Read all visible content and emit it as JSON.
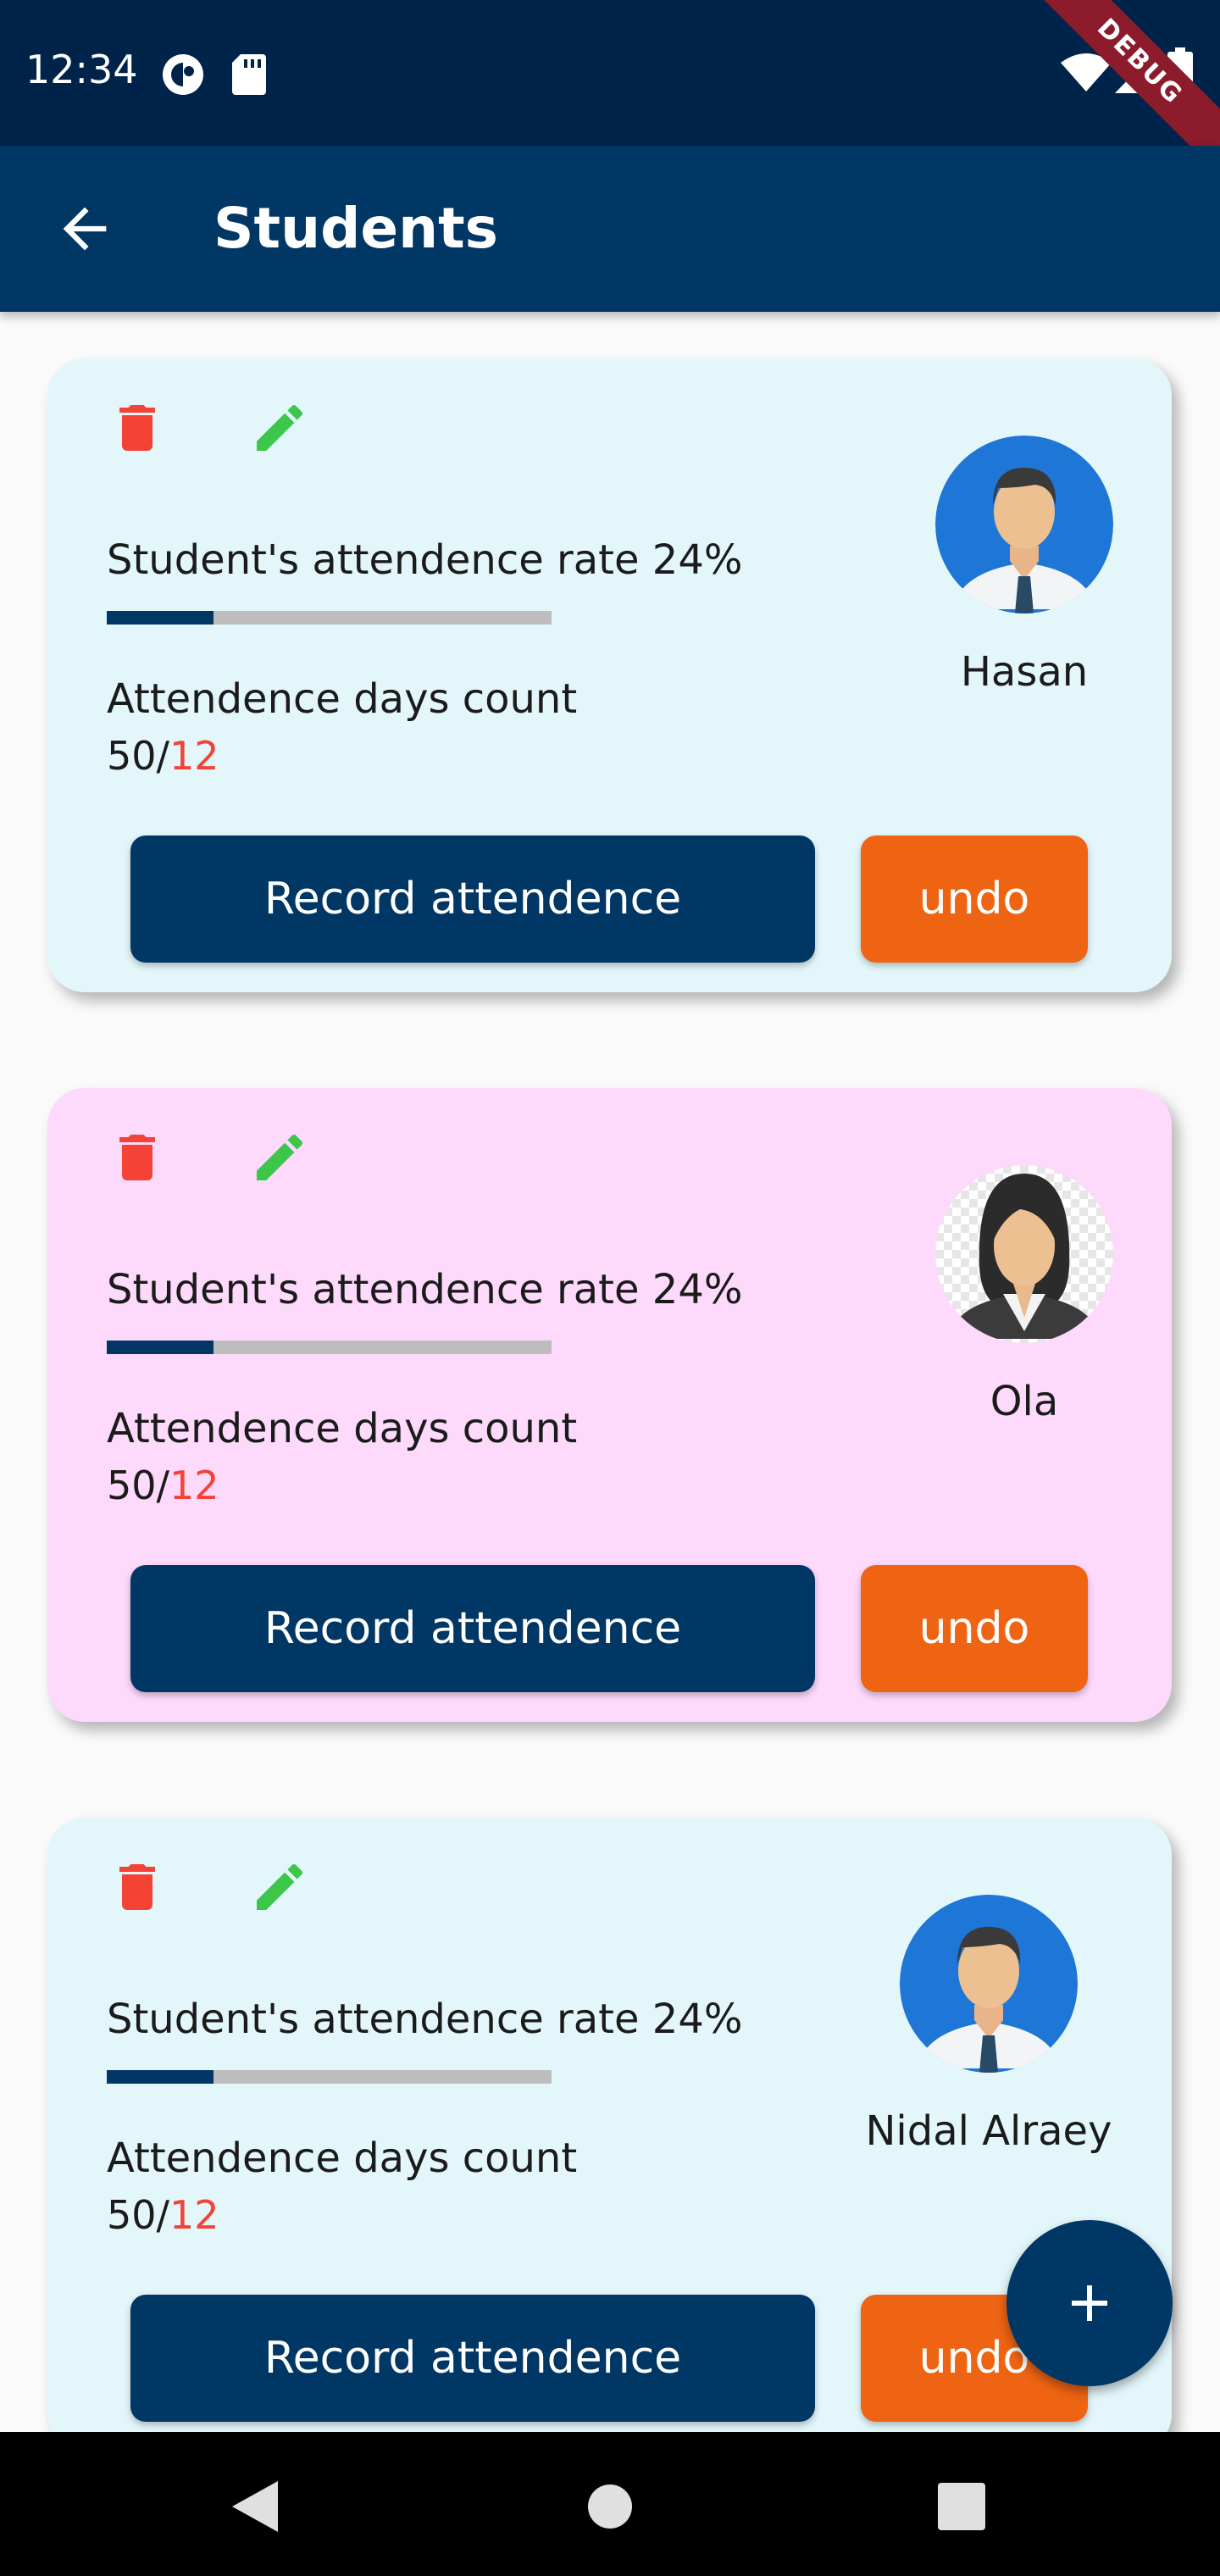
{
  "status_bar": {
    "time": "12:34",
    "icons": [
      "media-icon",
      "sd-card-icon",
      "wifi-icon",
      "signal-icon",
      "battery-icon"
    ],
    "debug_label": "DEBUG"
  },
  "app_bar": {
    "title": "Students",
    "back_icon": "arrow-back-icon"
  },
  "students": [
    {
      "name": "Hasan",
      "rate_label": "Student's attendence rate 24%",
      "rate_fraction": 0.24,
      "days_label": "Attendence days count",
      "days_total": "50/",
      "days_attended": "12",
      "record_label": "Record attendence",
      "undo_label": "undo",
      "card_color": "#e3f7fb",
      "avatar": "male-avatar"
    },
    {
      "name": "Ola",
      "rate_label": "Student's attendence rate 24%",
      "rate_fraction": 0.24,
      "days_label": "Attendence days count",
      "days_total": "50/",
      "days_attended": "12",
      "record_label": "Record attendence",
      "undo_label": "undo",
      "card_color": "#fdd9fb",
      "avatar": "female-avatar"
    },
    {
      "name": "Nidal Alraey",
      "rate_label": "Student's attendence rate 24%",
      "rate_fraction": 0.24,
      "days_label": "Attendence days count",
      "days_total": "50/",
      "days_attended": "12",
      "record_label": "Record attendence",
      "undo_label": "undo",
      "card_color": "#e3f7fb",
      "avatar": "male-avatar"
    }
  ],
  "fab": {
    "icon": "plus-icon"
  },
  "nav_bar": {
    "icons": [
      "back-triangle-icon",
      "home-circle-icon",
      "recents-square-icon"
    ]
  },
  "colors": {
    "primary": "#013764",
    "accent_orange": "#ee6412",
    "delete_red": "#f44336",
    "edit_green": "#3cc74a",
    "attended_red": "#f44336"
  }
}
